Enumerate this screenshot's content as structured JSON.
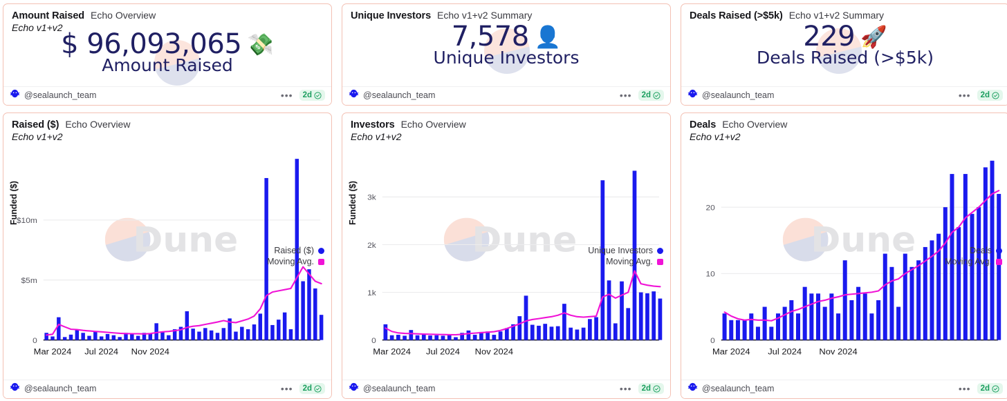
{
  "theme": {
    "card_border": "#f3c0b3",
    "bar_color": "#1a1aee",
    "line_color": "#f013d6",
    "number_color": "#202063",
    "badge_bg": "#e4f7ec",
    "badge_fg": "#1a9e5e",
    "watermark_text": "Dune"
  },
  "footer": {
    "handle": "@sealaunch_team",
    "menu": "•••",
    "age": "2d",
    "verified_icon": "verified-check-icon",
    "logo_icon": "sealaunch-logo-icon"
  },
  "cards": [
    {
      "id": "amount-raised",
      "title": "Amount Raised",
      "subtitle": "Echo Overview",
      "tagline": "Echo v1+v2",
      "kind": "counter",
      "value": "$ 96,093,065",
      "label": "Amount Raised",
      "emoji": "💸",
      "emoji_name": "money-with-wings-emoji"
    },
    {
      "id": "unique-investors",
      "title": "Unique Investors",
      "subtitle": "Echo v1+v2 Summary",
      "tagline": "",
      "kind": "counter",
      "value": "7,578",
      "label": "Unique Investors",
      "emoji": "👤",
      "emoji_name": "bust-in-silhouette-emoji"
    },
    {
      "id": "deals-raised",
      "title": "Deals Raised (>$5k)",
      "subtitle": "Echo v1+v2 Summary",
      "tagline": "",
      "kind": "counter",
      "value": "229",
      "label": "Deals Raised (>$5k)",
      "emoji": "🚀",
      "emoji_name": "rocket-emoji"
    },
    {
      "id": "raised-chart",
      "title": "Raised ($)",
      "subtitle": "Echo Overview",
      "tagline": "Echo v1+v2",
      "kind": "chart"
    },
    {
      "id": "investors-chart",
      "title": "Investors",
      "subtitle": "Echo Overview",
      "tagline": "Echo v1+v2",
      "kind": "chart"
    },
    {
      "id": "deals-chart",
      "title": "Deals",
      "subtitle": "Echo Overview",
      "tagline": "Echo v1+v2",
      "kind": "chart"
    }
  ],
  "chart_data": [
    {
      "id": "raised-chart",
      "type": "bar",
      "title": "Raised ($)",
      "subtitle": "Echo Overview",
      "xlabel": "",
      "ylabel": "Funded ($)",
      "ylim": [
        0,
        15500000
      ],
      "yticks": [
        0,
        5000000,
        10000000
      ],
      "ytick_labels": [
        "0",
        "$5m",
        "$10m"
      ],
      "xticks": [
        "Mar 2024",
        "Jul 2024",
        "Nov 2024"
      ],
      "xtick_index": [
        1,
        9,
        17
      ],
      "grid": true,
      "legend_position": "right",
      "legend": [
        "Raised ($)",
        "Moving Avg."
      ],
      "series": [
        {
          "name": "Raised ($)",
          "kind": "bar",
          "color": "#1a1aee",
          "values": [
            600000,
            300000,
            1900000,
            250000,
            450000,
            900000,
            600000,
            350000,
            750000,
            300000,
            500000,
            400000,
            250000,
            600000,
            550000,
            350000,
            600000,
            500000,
            1400000,
            700000,
            400000,
            900000,
            1100000,
            2400000,
            950000,
            700000,
            1000000,
            800000,
            600000,
            1000000,
            1800000,
            700000,
            1100000,
            900000,
            1300000,
            2200000,
            13500000,
            1250000,
            1700000,
            2300000,
            900000,
            15100000,
            4900000,
            5900000,
            4300000,
            2100000
          ]
        },
        {
          "name": "Moving Avg.",
          "kind": "line",
          "color": "#f013d6",
          "values": [
            420000,
            480000,
            1300000,
            1100000,
            900000,
            870000,
            800000,
            760000,
            720000,
            680000,
            640000,
            600000,
            560000,
            540000,
            530000,
            520000,
            510000,
            540000,
            620000,
            680000,
            720000,
            780000,
            860000,
            1050000,
            1150000,
            1200000,
            1300000,
            1400000,
            1500000,
            1620000,
            1500000,
            1450000,
            1600000,
            1750000,
            2000000,
            2600000,
            3700000,
            4000000,
            4100000,
            4200000,
            4300000,
            5200000,
            6100000,
            5500000,
            4900000,
            4700000
          ]
        }
      ]
    },
    {
      "id": "investors-chart",
      "type": "bar",
      "title": "Investors",
      "subtitle": "Echo Overview",
      "xlabel": "",
      "ylabel": "Funded ($)",
      "ylim": [
        0,
        3900
      ],
      "yticks": [
        0,
        1000,
        2000,
        3000
      ],
      "ytick_labels": [
        "0",
        "1k",
        "2k",
        "3k"
      ],
      "xticks": [
        "Mar 2024",
        "Jul 2024",
        "Nov 2024"
      ],
      "xtick_index": [
        1,
        9,
        17
      ],
      "grid": true,
      "legend_position": "right",
      "legend": [
        "Unique Investors",
        "Moving Avg."
      ],
      "series": [
        {
          "name": "Unique Investors",
          "kind": "bar",
          "color": "#1a1aee",
          "values": [
            330,
            100,
            110,
            90,
            210,
            100,
            120,
            95,
            100,
            90,
            110,
            60,
            150,
            200,
            110,
            170,
            180,
            110,
            180,
            250,
            330,
            500,
            930,
            320,
            300,
            340,
            280,
            290,
            760,
            260,
            220,
            260,
            440,
            480,
            3350,
            1250,
            350,
            1230,
            670,
            3550,
            1000,
            980,
            1020,
            870
          ]
        },
        {
          "name": "Moving Avg.",
          "kind": "line",
          "color": "#f013d6",
          "values": [
            250,
            180,
            150,
            140,
            135,
            130,
            125,
            120,
            118,
            115,
            112,
            110,
            120,
            135,
            145,
            155,
            165,
            175,
            200,
            240,
            290,
            340,
            400,
            430,
            450,
            470,
            490,
            520,
            570,
            520,
            490,
            480,
            490,
            500,
            900,
            960,
            880,
            940,
            1000,
            1450,
            1180,
            1150,
            1130,
            1120
          ]
        }
      ]
    },
    {
      "id": "deals-chart",
      "type": "bar",
      "title": "Deals",
      "subtitle": "Echo Overview",
      "xlabel": "",
      "ylabel": "",
      "ylim": [
        0,
        28
      ],
      "yticks": [
        0,
        10,
        20
      ],
      "ytick_labels": [
        "0",
        "10",
        "20"
      ],
      "xticks": [
        "Mar 2024",
        "Jul 2024",
        "Nov 2024"
      ],
      "xtick_index": [
        1,
        9,
        17
      ],
      "grid": true,
      "legend_position": "right",
      "legend": [
        "Deals",
        "Moving Avg."
      ],
      "series": [
        {
          "name": "Deals",
          "kind": "bar",
          "color": "#1a1aee",
          "values": [
            4,
            3,
            3,
            3,
            4,
            2,
            5,
            2,
            4,
            5,
            6,
            4,
            8,
            7,
            7,
            5,
            7,
            4,
            12,
            6,
            8,
            7,
            4,
            6,
            13,
            11,
            5,
            13,
            11,
            12,
            14,
            15,
            16,
            20,
            25,
            17,
            25,
            19,
            20,
            26,
            27,
            22
          ]
        },
        {
          "name": "Moving Avg.",
          "kind": "line",
          "color": "#f013d6",
          "values": [
            4.2,
            3.6,
            3.2,
            3.0,
            3.1,
            3.0,
            3.0,
            2.9,
            3.3,
            3.8,
            4.3,
            4.6,
            5.0,
            5.4,
            5.8,
            6.0,
            6.3,
            6.5,
            6.8,
            6.9,
            7.0,
            7.1,
            7.2,
            7.4,
            8.3,
            8.9,
            9.2,
            10.0,
            10.6,
            11.2,
            11.9,
            12.6,
            13.4,
            14.6,
            16.2,
            17.0,
            18.4,
            19.2,
            20.0,
            21.0,
            22.0,
            22.5
          ]
        }
      ]
    }
  ]
}
